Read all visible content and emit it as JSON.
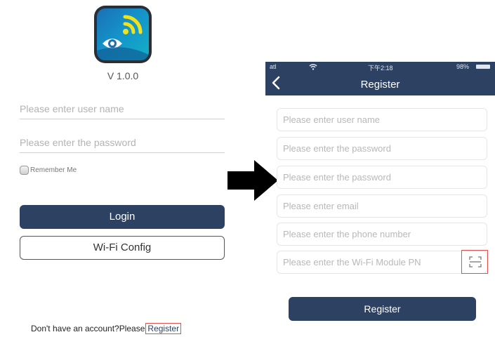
{
  "login_screen": {
    "version": "V 1.0.0",
    "username_placeholder": "Please enter user name",
    "password_placeholder": "Please enter the password",
    "remember_label": "Remember Me",
    "login_button": "Login",
    "wifi_config_button": "Wi-Fi Config",
    "footer_text": "Don't have an account?Please",
    "register_link": "Register"
  },
  "register_screen": {
    "status_bar": {
      "signal": "atl",
      "time": "下午2:18",
      "battery": "98%"
    },
    "title": "Register",
    "fields": [
      "Please enter user name",
      "Please enter the password",
      "Please enter the password",
      "Please enter email",
      "Please enter the phone number",
      "Please enter the Wi-Fi Module PN"
    ],
    "register_button": "Register"
  },
  "colors": {
    "primary": "#2d4263",
    "highlight_border": "#e05050"
  },
  "icons": [
    "app-logo-icon",
    "checkbox-icon",
    "right-arrow-icon",
    "back-chevron-icon",
    "wifi-icon",
    "scan-icon",
    "battery-icon"
  ]
}
